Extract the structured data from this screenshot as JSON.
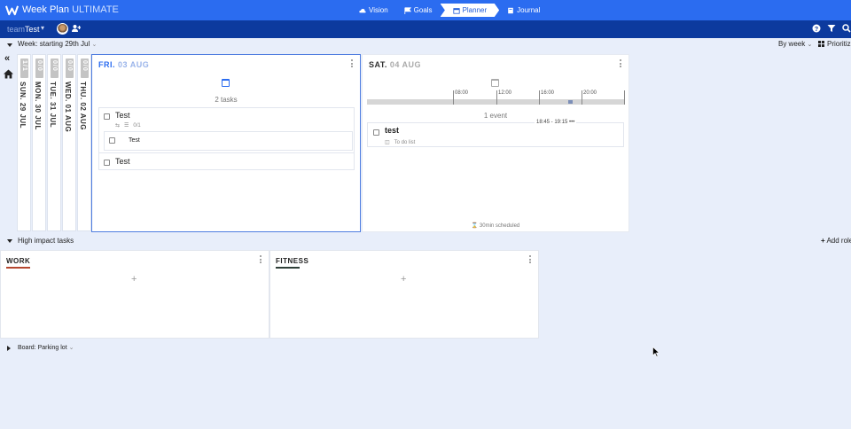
{
  "app": {
    "title": "Week Plan",
    "edition": "ULTIMATE",
    "brand_color": "#2b6cf0"
  },
  "nav": [
    {
      "label": "Vision",
      "icon": "cloud-icon"
    },
    {
      "label": "Goals",
      "icon": "flag-icon"
    },
    {
      "label": "Planner",
      "icon": "calendar-icon",
      "active": true
    },
    {
      "label": "Journal",
      "icon": "book-icon"
    }
  ],
  "team": {
    "prefix": "team",
    "name": "Test"
  },
  "week": {
    "label": "Week: starting 29th Jul",
    "view": "By week",
    "prioritize": "Prioritize"
  },
  "collapsed_days": [
    {
      "stamp": "1/1",
      "label": "SUN. 29 JUL"
    },
    {
      "stamp": "0/0",
      "label": "MON. 30 JUL"
    },
    {
      "stamp": "0/0",
      "label": "TUE. 31 JUL"
    },
    {
      "stamp": "0/0",
      "label": "WED. 01 AUG"
    },
    {
      "stamp": "0/0",
      "label": "THU. 02 AUG"
    }
  ],
  "friday": {
    "dow": "FRI.",
    "date": "03 AUG",
    "count": "2 tasks",
    "tasks": [
      {
        "title": "Test",
        "subtask_count": "0/1",
        "subtask": "Test"
      },
      {
        "title": "Test"
      }
    ]
  },
  "saturday": {
    "dow": "SAT.",
    "date": "04 AUG",
    "timeline": [
      "08:00",
      "12:00",
      "16:00",
      "20:00"
    ],
    "count": "1 event",
    "event": {
      "time": "18:45 - 19:15",
      "title": "test",
      "list": "To do list"
    },
    "scheduled": "30min scheduled"
  },
  "high_impact": {
    "label": "High impact tasks",
    "add_role": "Add role"
  },
  "roles": [
    {
      "name": "WORK",
      "color": "#b5472f"
    },
    {
      "name": "FITNESS",
      "color": "#2f3f38"
    }
  ],
  "parking": {
    "label": "Board: Parking lot"
  }
}
